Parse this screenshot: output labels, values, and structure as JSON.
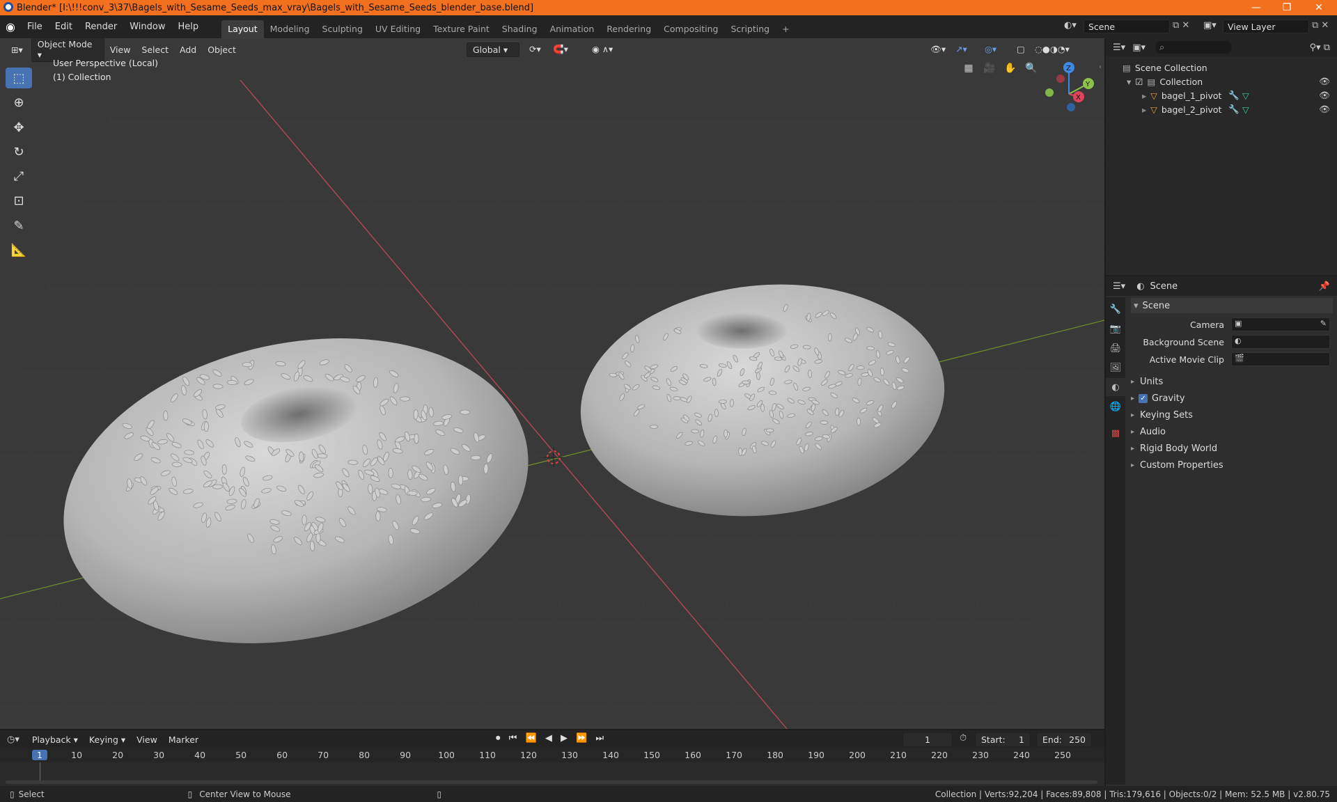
{
  "window": {
    "title": "Blender* [I:\\!!!conv_3\\37\\Bagels_with_Sesame_Seeds_max_vray\\Bagels_with_Sesame_Seeds_blender_base.blend]",
    "minimize": "—",
    "maximize": "❐",
    "close": "✕"
  },
  "menubar": {
    "menus": [
      "File",
      "Edit",
      "Render",
      "Window",
      "Help"
    ],
    "workspaces": [
      "Layout",
      "Modeling",
      "Sculpting",
      "UV Editing",
      "Texture Paint",
      "Shading",
      "Animation",
      "Rendering",
      "Compositing",
      "Scripting"
    ],
    "add_tab": "+",
    "scene_name": "Scene",
    "view_layer": "View Layer"
  },
  "viewport": {
    "mode": "Object Mode",
    "menus": [
      "View",
      "Select",
      "Add",
      "Object"
    ],
    "orientation": "Global",
    "perspective_label": "User Perspective (Local)",
    "collection_label": "(1) Collection",
    "gizmo": {
      "z": "Z",
      "y": "Y",
      "x": "X"
    }
  },
  "outliner": {
    "search_placeholder": "",
    "root": "Scene Collection",
    "collection": "Collection",
    "items": [
      "bagel_1_pivot",
      "bagel_2_pivot"
    ]
  },
  "properties": {
    "header": "Scene",
    "panel": "Scene",
    "fields": {
      "camera": "Camera",
      "background_scene": "Background Scene",
      "active_movie_clip": "Active Movie Clip"
    },
    "subpanels": [
      "Units",
      "Gravity",
      "Keying Sets",
      "Audio",
      "Rigid Body World",
      "Custom Properties"
    ]
  },
  "timeline": {
    "menus": [
      "Playback",
      "Keying",
      "View",
      "Marker"
    ],
    "current_frame": "1",
    "start_label": "Start:",
    "start": "1",
    "end_label": "End:",
    "end": "250",
    "ticks": [
      "1",
      "10",
      "20",
      "30",
      "40",
      "50",
      "60",
      "70",
      "80",
      "90",
      "100",
      "110",
      "120",
      "130",
      "140",
      "150",
      "160",
      "170",
      "180",
      "190",
      "200",
      "210",
      "220",
      "230",
      "240",
      "250"
    ]
  },
  "statusbar": {
    "select": "Select",
    "center_view": "Center View to Mouse",
    "stats": "Collection | Verts:92,204 | Faces:89,808 | Tris:179,616 | Objects:0/2 | Mem: 52.5 MB | v2.80.75"
  },
  "colors": {
    "title_bar": "#f3701e",
    "active_tool": "#4772b3",
    "x_axis": "#e0445a",
    "y_axis": "#8bc34a",
    "z_axis": "#3c8ae6"
  }
}
